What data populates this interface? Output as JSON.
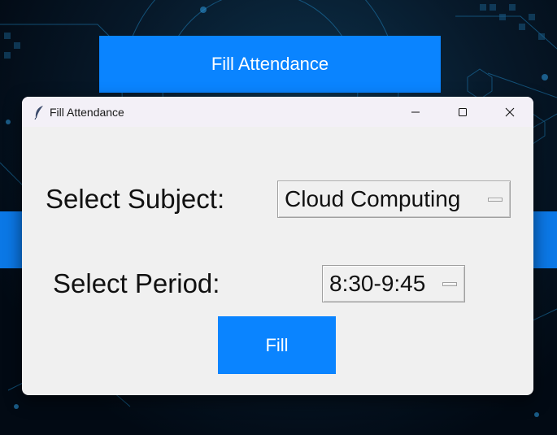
{
  "background": {
    "top_button_label": "Fill Attendance",
    "accent_color": "#0a84ff"
  },
  "window": {
    "title": "Fill Attendance",
    "icon": "feather-icon",
    "controls": {
      "minimize": "minimize-icon",
      "maximize": "maximize-icon",
      "close": "close-icon"
    }
  },
  "form": {
    "subject_label": "Select Subject:",
    "subject_value": "Cloud Computing",
    "period_label": "Select Period:",
    "period_value": "8:30-9:45",
    "fill_button_label": "Fill"
  }
}
